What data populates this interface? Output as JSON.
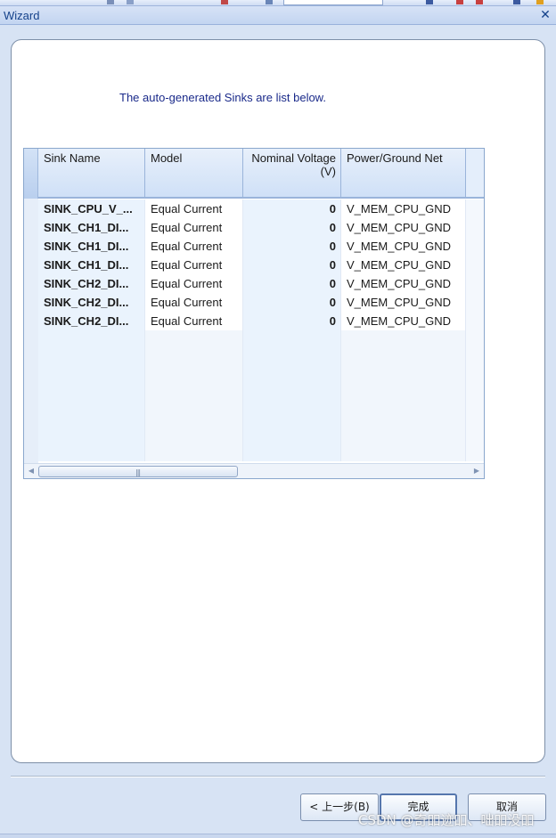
{
  "window": {
    "title": "Wizard",
    "close_glyph": "✕"
  },
  "intro_text": "The auto-generated Sinks are list below.",
  "table": {
    "columns": [
      "Sink Name",
      "Model",
      "Nominal Voltage",
      "(V)",
      "Power/Ground Net"
    ],
    "rows": [
      {
        "sink_name": "SINK_CPU_V_...",
        "model": "Equal Current",
        "nominal_voltage": "0",
        "net": "V_MEM_CPU_GND"
      },
      {
        "sink_name": "SINK_CH1_DI...",
        "model": "Equal Current",
        "nominal_voltage": "0",
        "net": "V_MEM_CPU_GND"
      },
      {
        "sink_name": "SINK_CH1_DI...",
        "model": "Equal Current",
        "nominal_voltage": "0",
        "net": "V_MEM_CPU_GND"
      },
      {
        "sink_name": "SINK_CH1_DI...",
        "model": "Equal Current",
        "nominal_voltage": "0",
        "net": "V_MEM_CPU_GND"
      },
      {
        "sink_name": "SINK_CH2_DI...",
        "model": "Equal Current",
        "nominal_voltage": "0",
        "net": "V_MEM_CPU_GND"
      },
      {
        "sink_name": "SINK_CH2_DI...",
        "model": "Equal Current",
        "nominal_voltage": "0",
        "net": "V_MEM_CPU_GND"
      },
      {
        "sink_name": "SINK_CH2_DI...",
        "model": "Equal Current",
        "nominal_voltage": "0",
        "net": "V_MEM_CPU_GND"
      }
    ]
  },
  "scrollbar": {
    "left_arrow": "◀",
    "right_arrow": "▶",
    "grip": "|||"
  },
  "buttons": {
    "back": "< 上一步(B)",
    "finish": "完成",
    "cancel": "取消"
  },
  "watermark": "CSDN @奇吅迹吅、咄吅没吅",
  "colors": {
    "title_text": "#15428b",
    "intro_text": "#1a2a8a",
    "frame": "#d7e3f4"
  }
}
